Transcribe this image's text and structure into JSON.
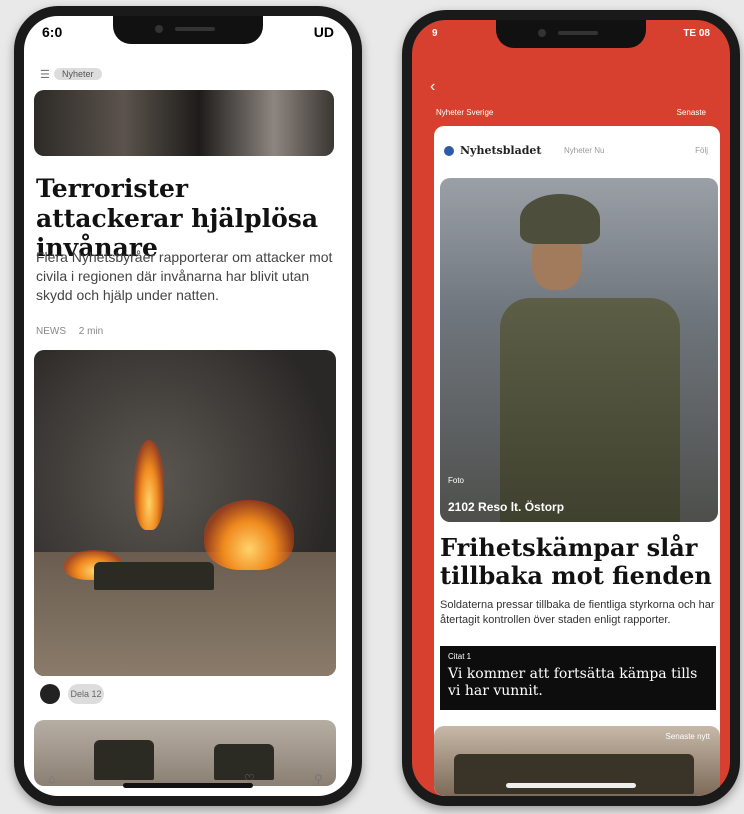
{
  "left_phone": {
    "status_time": "6:0",
    "status_icons": "UD",
    "tab_label": "Nyheter",
    "top_article": {
      "headline": "Terrorister attackerar hjälplösa invånare",
      "summary": "Flera Nyhetsbyråer rapporterar om attacker mot civila i regionen där invånarna har blivit utan skydd och hjälp under natten.",
      "source": "NEWS",
      "time": "2 min"
    },
    "share_label": "Dela 12",
    "bottom_nav": [
      "⌂",
      "♡",
      "⚲"
    ]
  },
  "right_phone": {
    "status_time": "9",
    "status_icons": "TE 08",
    "back_icon": "‹",
    "header_left": "Nyheter Sverige",
    "header_right": "Senaste",
    "source_name": "Nyhetsbladet",
    "source_meta": "Nyheter Nu",
    "follow_label": "Följ",
    "photo_caption_small": "Foto",
    "photo_caption": "2102 Reso lt. Östorp",
    "headline": "Frihetskämpar slår tillbaka mot fienden",
    "summary": "Soldaterna pressar tillbaka de fientliga styrkorna och har återtagit kontrollen över staden enligt rapporter.",
    "quote_label": "Citat 1",
    "quote_text": "Vi kommer att fortsätta kämpa tills vi har vunnit.",
    "bottom_caption": "Senaste nytt"
  }
}
